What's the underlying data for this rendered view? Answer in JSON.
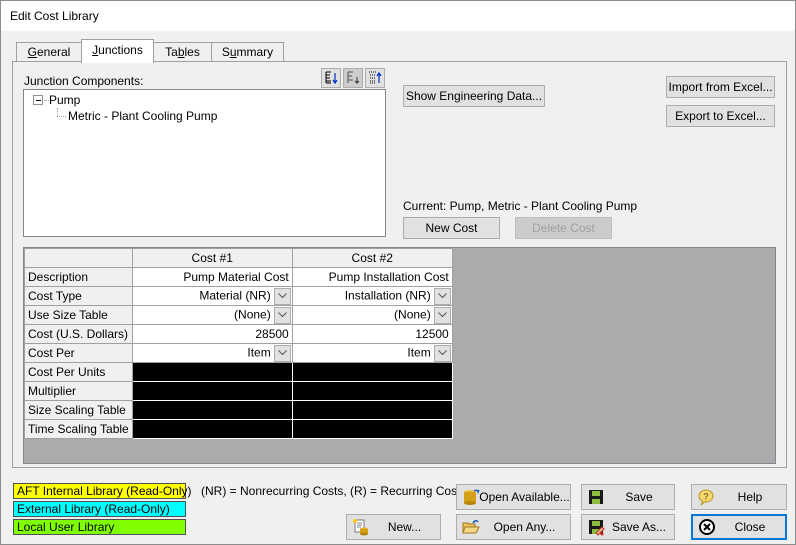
{
  "window": {
    "title": "Edit Cost Library"
  },
  "tabs": [
    {
      "label": "General",
      "underline": "G",
      "active": false
    },
    {
      "label": "Junctions",
      "underline": "J",
      "active": true
    },
    {
      "label": "Tables",
      "underline": "b",
      "active": false
    },
    {
      "label": "Summary",
      "underline": "u",
      "active": false
    }
  ],
  "junctions": {
    "components_label": "Junction Components:",
    "tree": {
      "root": "Pump",
      "child": "Metric - Plant Cooling Pump"
    },
    "tree_toolbar": [
      {
        "icon": "expand-all-icon"
      },
      {
        "icon": "expand-one-icon"
      },
      {
        "icon": "collapse-all-icon"
      }
    ],
    "show_engineering_data": "Show Engineering Data...",
    "import_excel": "Import from Excel...",
    "export_excel": "Export to Excel...",
    "current_label": "Current: Pump, Metric - Plant Cooling Pump",
    "new_cost": "New Cost",
    "delete_cost": "Delete Cost"
  },
  "grid": {
    "columns": [
      "Cost #1",
      "Cost #2"
    ],
    "rows": [
      {
        "label": "Description",
        "values": [
          "Pump Material Cost",
          "Pump Installation Cost"
        ],
        "dropdown": false,
        "blocked": false
      },
      {
        "label": "Cost Type",
        "values": [
          "Material (NR)",
          "Installation (NR)"
        ],
        "dropdown": true,
        "blocked": false
      },
      {
        "label": "Use Size Table",
        "values": [
          "(None)",
          "(None)"
        ],
        "dropdown": true,
        "blocked": false
      },
      {
        "label": "Cost (U.S. Dollars)",
        "values": [
          "28500",
          "12500"
        ],
        "dropdown": false,
        "blocked": false
      },
      {
        "label": "Cost Per",
        "values": [
          "Item",
          "Item"
        ],
        "dropdown": true,
        "blocked": false
      },
      {
        "label": "Cost Per Units",
        "values": [
          "",
          ""
        ],
        "dropdown": false,
        "blocked": true
      },
      {
        "label": "Multiplier",
        "values": [
          "",
          ""
        ],
        "dropdown": false,
        "blocked": true
      },
      {
        "label": "Size Scaling Table",
        "values": [
          "",
          ""
        ],
        "dropdown": false,
        "blocked": true
      },
      {
        "label": "Time Scaling Table",
        "values": [
          "",
          ""
        ],
        "dropdown": false,
        "blocked": true
      }
    ]
  },
  "legend": [
    {
      "label": "AFT Internal Library (Read-Only)",
      "color": "#ffff00"
    },
    {
      "label": "External Library (Read-Only)",
      "color": "#00ffff"
    },
    {
      "label": "Local User Library",
      "color": "#80ff00"
    }
  ],
  "legend_note": "(NR) = Nonrecurring Costs, (R) = Recurring Costs",
  "buttons": {
    "new": "New...",
    "open_available": "Open Available...",
    "open_any": "Open Any...",
    "save": "Save",
    "save_as": "Save As...",
    "help": "Help",
    "close": "Close"
  }
}
